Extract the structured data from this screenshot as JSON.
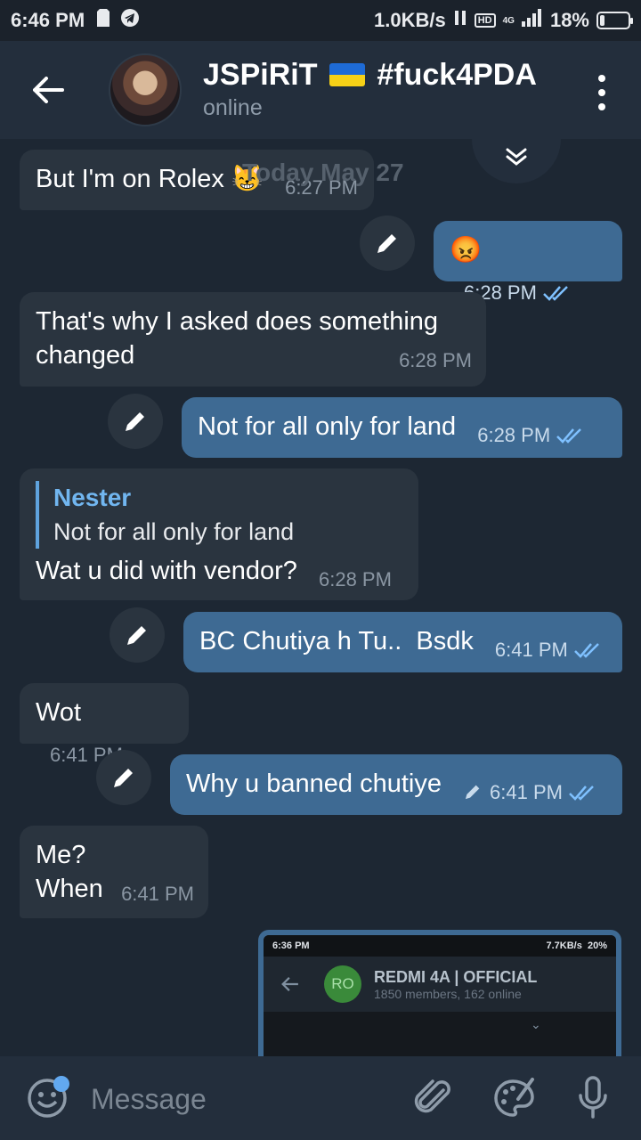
{
  "status_bar": {
    "time": "6:46 PM",
    "speed": "1.0KB/s",
    "hd": "HD",
    "network": "4G",
    "battery": "18%",
    "battery_level": 0.18
  },
  "header": {
    "title_left": "JSPiRiT",
    "title_right": "#fuck4PDA",
    "status": "online"
  },
  "chat": {
    "date_float": "Today May 27",
    "messages": [
      {
        "dir": "in",
        "text": "But I'm on Rolex 😸",
        "time": "6:27 PM"
      },
      {
        "dir": "out",
        "text": "😡",
        "time": "6:28 PM"
      },
      {
        "dir": "in",
        "text": "That's why I asked does something changed",
        "time": "6:28 PM"
      },
      {
        "dir": "out",
        "text": "Not for all only for land",
        "time": "6:28 PM"
      },
      {
        "dir": "in",
        "reply_name": "Nester",
        "reply_text": "Not for all only for land",
        "text": "Wat u did with vendor?",
        "time": "6:28 PM"
      },
      {
        "dir": "out",
        "text": "BC Chutiya h Tu..  Bsdk",
        "time": "6:41 PM"
      },
      {
        "dir": "in",
        "text": "Wot",
        "time": "6:41 PM"
      },
      {
        "dir": "out",
        "text": "Why u banned chutiye",
        "time": "6:41 PM"
      },
      {
        "dir": "in",
        "text": "Me?\nWhen",
        "time": "6:41 PM"
      }
    ],
    "preview": {
      "time": "6:36 PM",
      "speed": "7.7KB/s",
      "battery": "20%",
      "avatar_text": "RO",
      "group_name": "REDMI 4A | OFFICIAL",
      "group_sub": "1850 members, 162 online"
    }
  },
  "composer": {
    "placeholder": "Message"
  }
}
